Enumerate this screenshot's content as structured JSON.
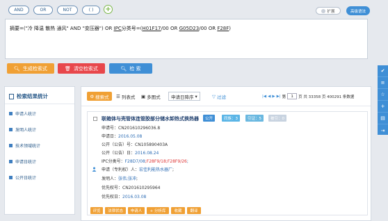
{
  "operators": [
    "AND",
    "OR",
    "NOT",
    "( )"
  ],
  "add_symbol": "+",
  "expand_label": "扩展",
  "advanced_label": "高级语法",
  "query": {
    "prefix": "摘要=(\"冷 降温 散热 通风\" AND \"变压器\") OR ",
    "ipc_label": "IPC",
    "middle": "分类号=(",
    "code1": "H01F17",
    "sep1": "/00 OR ",
    "code2": "G05D23",
    "sep2": "/00 OR ",
    "code3": "F28F",
    "suffix": ")"
  },
  "actions": {
    "generate": "生成检索式",
    "clear": "清空检索式",
    "search": "检 索"
  },
  "left_panel": {
    "title": "检索结果统计",
    "items": [
      "申请人统计",
      "发明人统计",
      "技术领域统计",
      "申请日统计",
      "公开日统计"
    ]
  },
  "toolbar": {
    "search_style": "搜索式",
    "list_style": "列表式",
    "multi_image": "多图式",
    "sort": "申请日降序",
    "filter": "过滤",
    "pager_prefix": "第",
    "page": "1",
    "pager_suffix": "页 共 33358 页 400291 条数据"
  },
  "result": {
    "title": "联箱体与壳管体连管胶部分储水卸热式换热器",
    "badges": [
      "公开",
      "同族：3",
      "引证：5",
      "被引：0"
    ],
    "fields": {
      "app_no_label": "申请号：",
      "app_no": "CN201610296036.8",
      "app_date_label": "申请日：",
      "app_date": "2016.05.08",
      "pub_no_label": "公开（公告）号：",
      "pub_no": "CN105890403A",
      "pub_date_label": "公开（公告）日：",
      "pub_date": "2016.08.24",
      "ipc_label": "IPC分类号：",
      "ipc_val1": "F28D7/08",
      "ipc_val2": ";F28F9/18",
      "ipc_val3": ";F28F9/26",
      "ipc_val4": ";",
      "applicant_label": "申请（专利权）人：",
      "applicant": "宏佳利能热水器厂",
      "applicant_suffix": ";",
      "inventor_label": "发明人：",
      "inventor": "张伟;张冲",
      "inventor_suffix": ";",
      "priority_no_label": "优先权号：",
      "priority_no": "CN201610295964",
      "priority_date_label": "优先权日：",
      "priority_date": "2016.03.08"
    },
    "bottom_buttons": [
      "评览",
      "法律状态",
      "申请人",
      "+ 分析库",
      "收藏",
      "翻译"
    ]
  },
  "colors": {
    "primary": "#3f8fd6",
    "orange": "#f0a034",
    "red_btn": "#e8474b",
    "badge_publish": "#3f8fd6",
    "badge_family": "#5bb5e6",
    "badge_cite": "#6ab8e0",
    "badge_cited": "#c8d3e0"
  }
}
